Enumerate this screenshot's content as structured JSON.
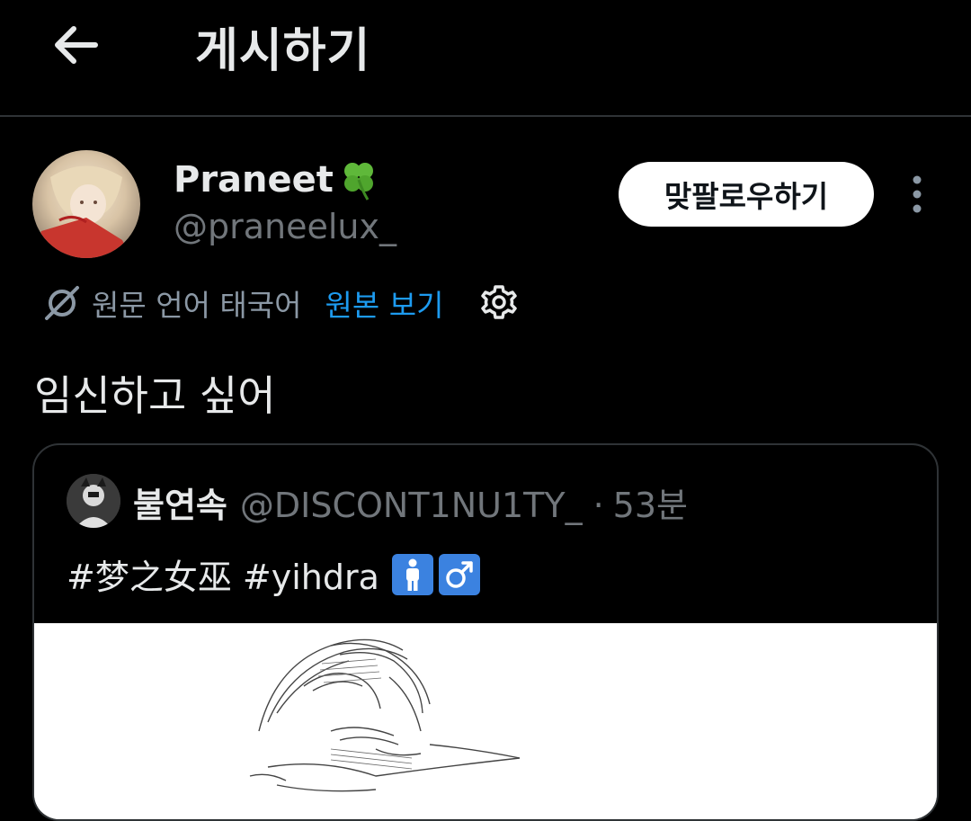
{
  "header": {
    "back_icon": "arrow-left-icon",
    "title": "게시하기"
  },
  "post": {
    "author": {
      "display_name": "Praneet",
      "name_emoji": "four-leaf-clover-icon",
      "handle": "@praneelux_"
    },
    "follow_button": "맞팔로우하기",
    "more_icon": "more-vertical-icon",
    "translation": {
      "icon": "translate-slash-icon",
      "text": "원문 언어 태국어",
      "show_original": "원본 보기",
      "settings_icon": "gear-icon"
    },
    "text": "임신하고 싶어",
    "quote": {
      "display_name": "불연속",
      "handle": "@DISCONT1NU1TY_",
      "separator": "·",
      "time": "53분",
      "text": "#梦之女巫 #yihdra",
      "emojis": [
        "man-symbol-icon",
        "male-sign-icon"
      ],
      "image": "sketch-drawing"
    }
  },
  "colors": {
    "background": "#000000",
    "primary_text": "#e7e9ea",
    "secondary_text": "#71767b",
    "link": "#1d9bf0",
    "divider": "#2f3336",
    "follow_bg": "#ffffff"
  }
}
